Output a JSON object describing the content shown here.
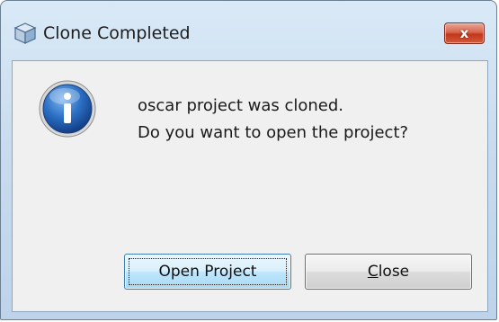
{
  "dialog": {
    "title": "Clone Completed",
    "close_glyph": "x",
    "title_icon": "cube-icon",
    "message_icon": "info-icon",
    "message_lines": [
      "oscar project was cloned.",
      "Do you want to open the project?"
    ]
  },
  "buttons": {
    "open_label": "Open Project",
    "close_label_mnemonic": "C",
    "close_label_rest": "lose"
  },
  "colors": {
    "title_bar": "#c9dcef",
    "close_button": "#c2371c",
    "info_icon": "#1f5fae",
    "default_button_border": "#3c7fb1"
  }
}
